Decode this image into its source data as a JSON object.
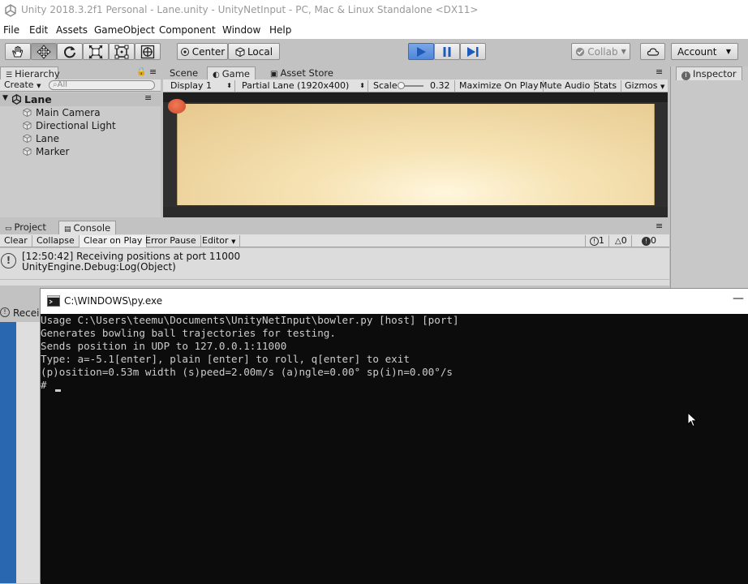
{
  "window": {
    "title": "Unity 2018.3.2f1 Personal - Lane.unity - UnityNetInput - PC, Mac & Linux Standalone <DX11>"
  },
  "menu": [
    "File",
    "Edit",
    "Assets",
    "GameObject",
    "Component",
    "Window",
    "Help"
  ],
  "toolbar": {
    "pivot_label": "Center",
    "space_label": "Local",
    "collab_label": "Collab",
    "account_label": "Account"
  },
  "hierarchy": {
    "tab": "Hierarchy",
    "create_label": "Create",
    "search_placeholder": "All",
    "scene": "Lane",
    "items": [
      "Main Camera",
      "Directional Light",
      "Lane",
      "Marker"
    ]
  },
  "game": {
    "tabs": [
      "Scene",
      "Game",
      "Asset Store"
    ],
    "display": "Display 1",
    "resolution": "Partial Lane (1920x400)",
    "scale_label": "Scale",
    "scale_value": "0.32",
    "maximize": "Maximize On Play",
    "mute": "Mute Audio",
    "stats": "Stats",
    "gizmos": "Gizmos"
  },
  "inspector": {
    "tab": "Inspector"
  },
  "console": {
    "tabs": [
      "Project",
      "Console"
    ],
    "buttons": [
      "Clear",
      "Collapse",
      "Clear on Play",
      "Error Pause",
      "Editor"
    ],
    "counts": {
      "info": "1",
      "warn": "0",
      "error": "0"
    },
    "log_line1": "[12:50:42] Receiving positions at port 11000",
    "log_line2": "UnityEngine.Debug:Log(Object)"
  },
  "statusbar": {
    "text": "Recei"
  },
  "pywin": {
    "title": "C:\\WINDOWS\\py.exe",
    "lines": [
      "Usage C:\\Users\\teemu\\Documents\\UnityNetInput\\bowler.py [host] [port]",
      "Generates bowling ball trajectories for testing.",
      "Sends position in UDP to 127.0.0.1:11000",
      "Type: a=-5.1[enter], plain [enter] to roll, q[enter] to exit",
      "(p)osition=0.53m width (s)peed=2.00m/s (a)ngle=0.00° sp(i)n=0.00°/s",
      "# "
    ]
  }
}
